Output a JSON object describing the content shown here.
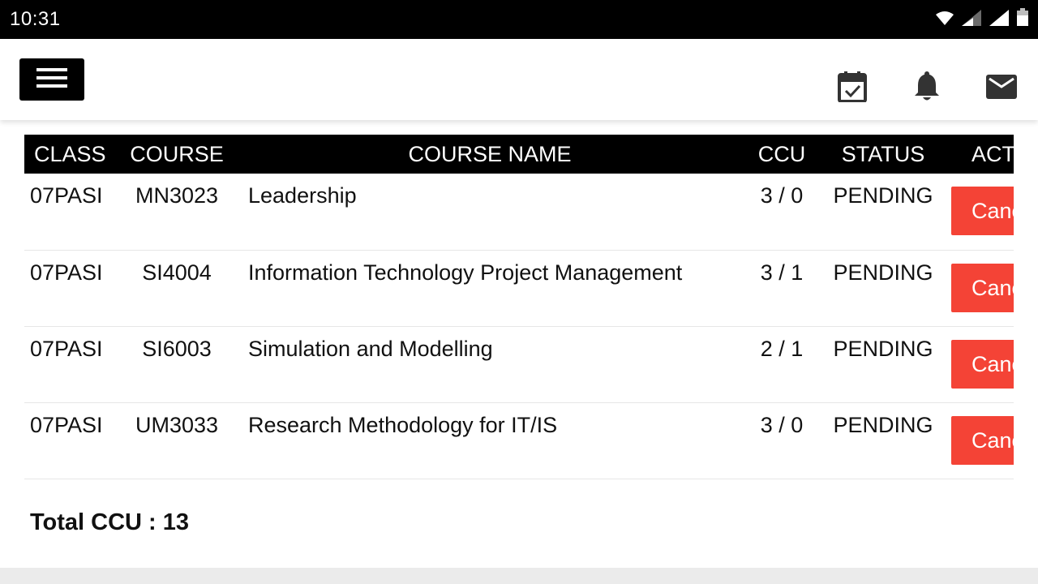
{
  "status_bar": {
    "time": "10:31",
    "icons": [
      "wifi-icon",
      "signal-icon",
      "signal-icon",
      "battery-icon"
    ]
  },
  "app_bar": {
    "menu_icon": "menu-icon",
    "actions": [
      "calendar-check-icon",
      "bell-icon",
      "mail-icon"
    ]
  },
  "table": {
    "headers": {
      "class": "CLASS",
      "course": "COURSE",
      "course_name": "COURSE NAME",
      "ccu": "CCU",
      "status": "STATUS",
      "action": "ACTION"
    },
    "rows": [
      {
        "class": "07PASI",
        "course": "MN3023",
        "course_name": "Leadership",
        "ccu": "3 / 0",
        "status": "PENDING",
        "action_label": "Cancel"
      },
      {
        "class": "07PASI",
        "course": "SI4004",
        "course_name": "Information Technology Project Management",
        "ccu": "3 / 1",
        "status": "PENDING",
        "action_label": "Cancel"
      },
      {
        "class": "07PASI",
        "course": "SI6003",
        "course_name": "Simulation and Modelling",
        "ccu": "2 / 1",
        "status": "PENDING",
        "action_label": "Cancel"
      },
      {
        "class": "07PASI",
        "course": "UM3033",
        "course_name": "Research Methodology for IT/IS",
        "ccu": "3 / 0",
        "status": "PENDING",
        "action_label": "Cancel"
      }
    ]
  },
  "total_ccu": "Total CCU : 13",
  "colors": {
    "header_bg": "#000000",
    "cancel_button": "#f44336",
    "status_bar": "#000000"
  }
}
